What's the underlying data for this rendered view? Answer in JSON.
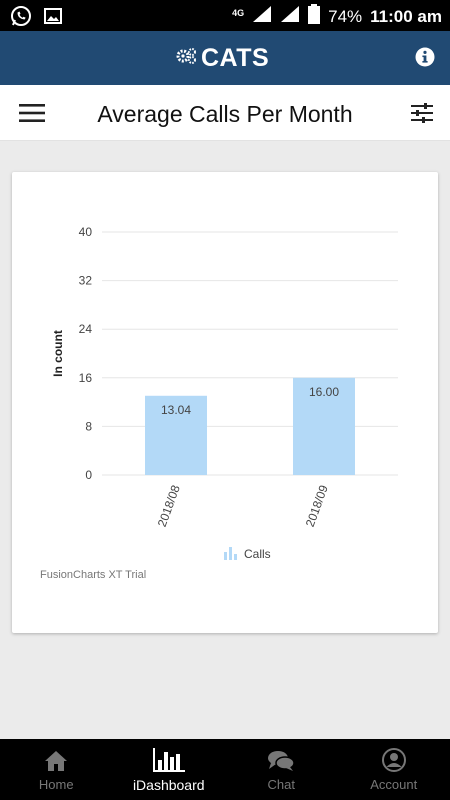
{
  "status_bar": {
    "network": "4G",
    "battery": "74%",
    "time": "11:00 am",
    "icons": [
      "whatsapp-icon",
      "gallery-icon",
      "signal-icon",
      "battery-icon"
    ]
  },
  "app_bar": {
    "logo_text": "CATS",
    "icons": [
      "gears-icon",
      "info-icon"
    ]
  },
  "title_bar": {
    "title": "Average Calls Per Month",
    "icons": [
      "menu-icon",
      "filter-icon"
    ]
  },
  "chart_data": {
    "type": "bar",
    "categories": [
      "2018/08",
      "2018/09"
    ],
    "series": [
      {
        "name": "Calls",
        "values": [
          13.04,
          16.0
        ]
      }
    ],
    "data_labels": [
      "13.04",
      "16.00"
    ],
    "ylabel": "In count",
    "xlabel": "",
    "ylim": [
      0,
      40
    ],
    "yticks": [
      "0",
      "8",
      "16",
      "24",
      "32",
      "40"
    ],
    "grid": true,
    "legend_position": "bottom",
    "bar_color": "#b3d9f7",
    "watermark": "FusionCharts XT Trial"
  },
  "bottom_nav": {
    "items": [
      {
        "label": "Home",
        "icon": "home-icon",
        "active": false
      },
      {
        "label": "iDashboard",
        "icon": "dashboard-icon",
        "active": true
      },
      {
        "label": "Chat",
        "icon": "chat-icon",
        "active": false
      },
      {
        "label": "Account",
        "icon": "account-icon",
        "active": false
      }
    ]
  }
}
